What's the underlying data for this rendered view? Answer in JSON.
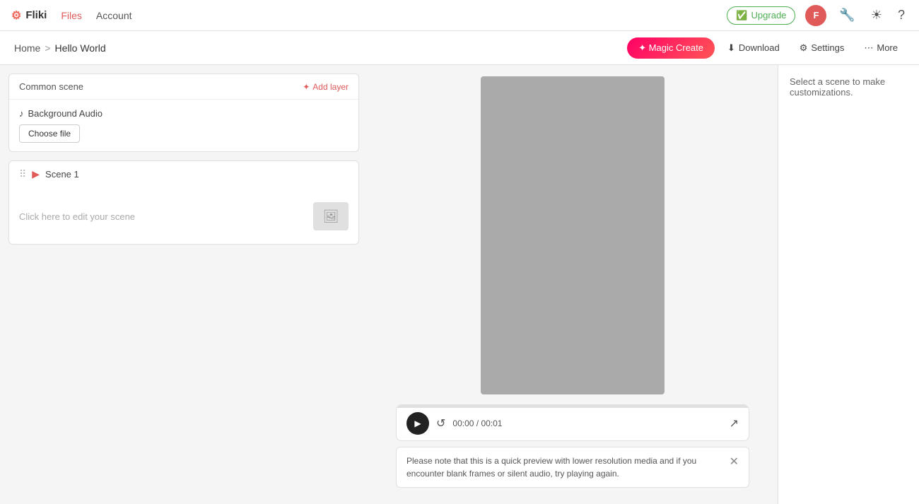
{
  "topNav": {
    "logo": "Fliki",
    "logoIcon": "⚙",
    "links": [
      {
        "label": "Files",
        "accent": true
      },
      {
        "label": "Account",
        "accent": false
      }
    ],
    "upgradeLabel": "Upgrade",
    "upgradeIcon": "✅",
    "avatarInitial": "F",
    "iconWrench": "🔧",
    "iconSun": "☀",
    "iconHelp": "?"
  },
  "breadcrumb": {
    "home": "Home",
    "separator": ">",
    "current": "Hello World"
  },
  "actions": {
    "magicCreate": "✦ Magic Create",
    "download": "Download",
    "settings": "Settings",
    "more": "More"
  },
  "leftPanel": {
    "commonScene": {
      "title": "Common scene",
      "addLayerLabel": "Add layer",
      "addLayerIcon": "✦",
      "bgAudioLabel": "Background Audio",
      "bgAudioIcon": "♪",
      "chooseFileLabel": "Choose file"
    },
    "scene1": {
      "title": "Scene 1",
      "placeholderText": "Click here to edit your scene",
      "dragHandle": "⠿"
    }
  },
  "preview": {
    "timeDisplay": "00:00 / 00:01",
    "progressWidth": "0"
  },
  "infoBanner": {
    "text": "Please note that this is a quick preview with lower resolution media and if you encounter blank frames or silent audio, try playing again."
  },
  "rightPanel": {
    "message": "Select a scene to make customizations."
  }
}
